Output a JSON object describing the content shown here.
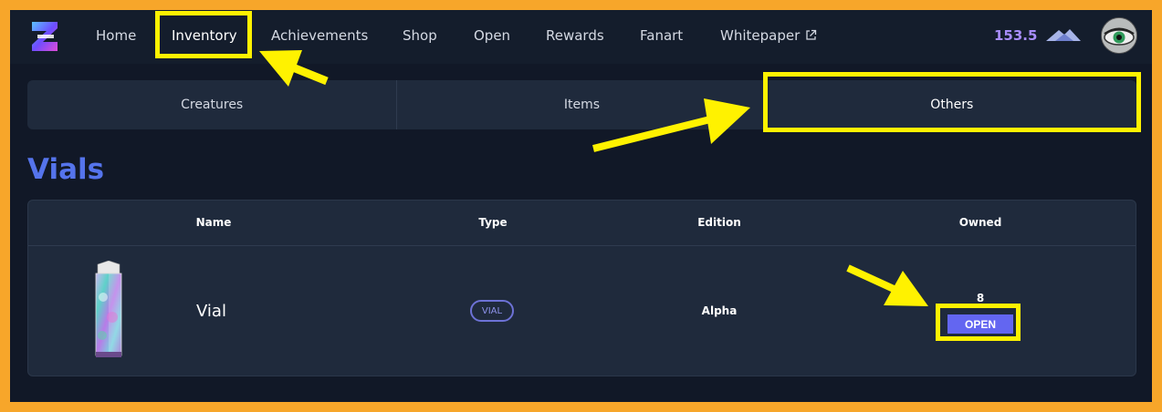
{
  "nav": {
    "items": [
      {
        "label": "Home"
      },
      {
        "label": "Inventory"
      },
      {
        "label": "Achievements"
      },
      {
        "label": "Shop"
      },
      {
        "label": "Open"
      },
      {
        "label": "Rewards"
      },
      {
        "label": "Fanart"
      },
      {
        "label": "Whitepaper"
      }
    ],
    "active": "Inventory",
    "balance": "153.5",
    "balance_icon": "mountain-icon",
    "external_icon": "external-link-icon"
  },
  "tabs": {
    "items": [
      {
        "label": "Creatures"
      },
      {
        "label": "Items"
      },
      {
        "label": "Others"
      }
    ],
    "active": "Others"
  },
  "section": {
    "title": "Vials"
  },
  "table": {
    "columns": [
      "Name",
      "Type",
      "Edition",
      "Owned"
    ],
    "rows": [
      {
        "name": "Vial",
        "type": "VIAL",
        "edition": "Alpha",
        "owned": "8",
        "action": "OPEN"
      }
    ]
  },
  "colors": {
    "frame": "#f7a62a",
    "background": "#111827",
    "panel": "#1f2a3c",
    "accent": "#5574ec",
    "button": "#6366f1",
    "highlight": "#fff200"
  }
}
